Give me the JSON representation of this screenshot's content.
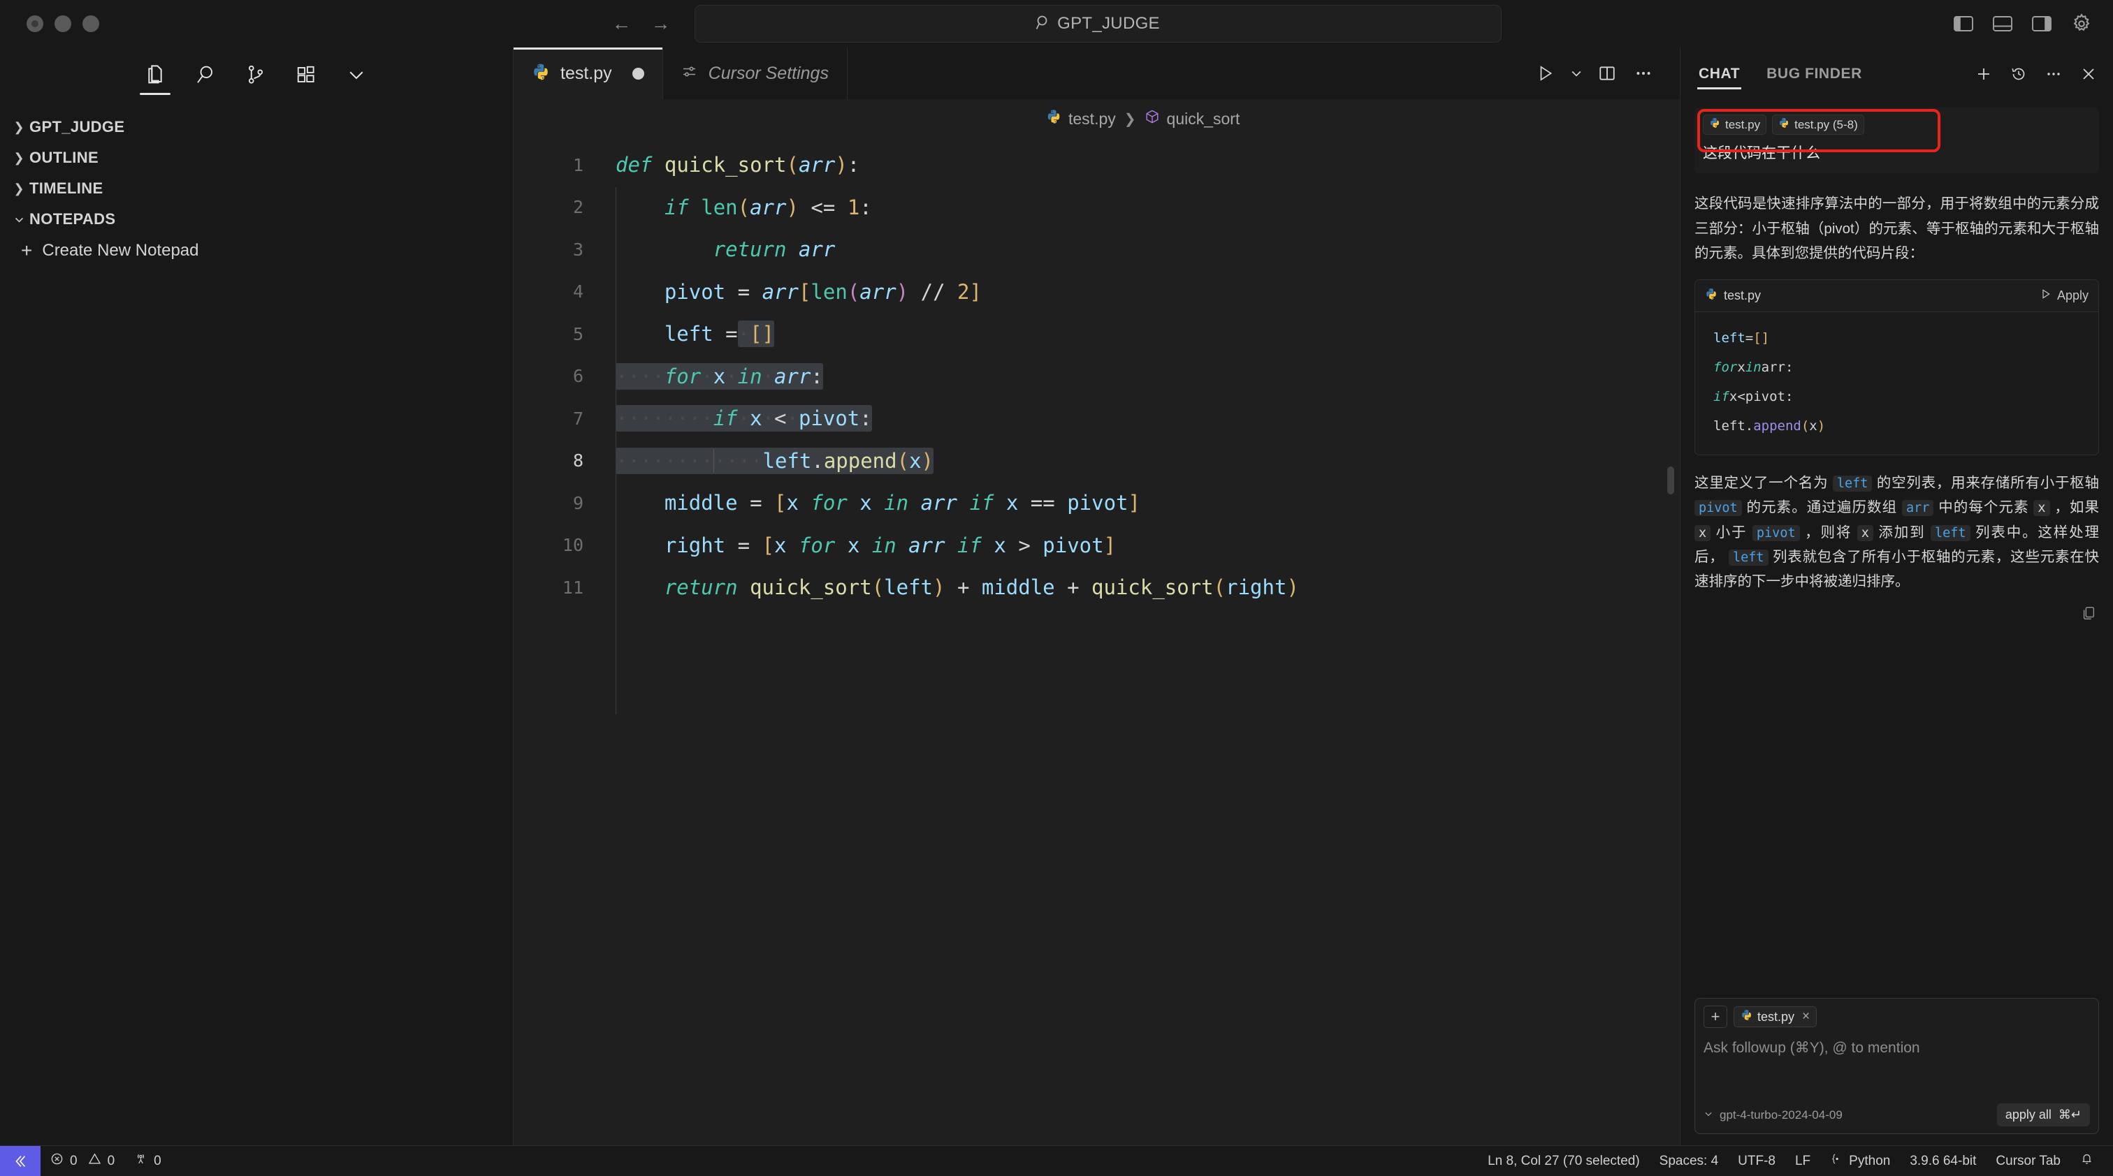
{
  "window": {
    "title": "GPT_JUDGE",
    "search_placeholder": "GPT_JUDGE",
    "traffic_lights": [
      "close",
      "minimize",
      "zoom"
    ]
  },
  "titlebar": {
    "back_icon": "←",
    "forward_icon": "→",
    "search_icon": "search-icon",
    "layout_buttons": [
      "toggle-primary-sidebar",
      "toggle-panel",
      "toggle-secondary-sidebar"
    ],
    "settings_icon": "gear-icon"
  },
  "sidebar": {
    "activity_icons": [
      "explorer-icon",
      "search-icon",
      "source-control-icon",
      "extensions-icon",
      "chevron-down-icon"
    ],
    "active_activity": "explorer-icon",
    "sections": [
      {
        "label": "GPT_JUDGE",
        "expanded": false
      },
      {
        "label": "OUTLINE",
        "expanded": false
      },
      {
        "label": "TIMELINE",
        "expanded": false
      },
      {
        "label": "NOTEPADS",
        "expanded": true
      }
    ],
    "notepad_action": "Create New Notepad"
  },
  "editor": {
    "tabs": [
      {
        "label": "test.py",
        "icon": "python-icon",
        "active": true,
        "dirty": true
      },
      {
        "label": "Cursor Settings",
        "icon": "settings-sliders-icon",
        "active": false,
        "dirty": false
      }
    ],
    "toolbar": [
      "run-icon",
      "chevron-down-icon",
      "split-editor-icon",
      "more-actions-icon"
    ],
    "breadcrumb": [
      {
        "label": "test.py",
        "icon": "python-icon"
      },
      {
        "label": "quick_sort",
        "icon": "symbol-method-icon"
      }
    ],
    "selection_lines": [
      6,
      7,
      8
    ],
    "lines": [
      {
        "n": 1,
        "text": "def quick_sort(arr):"
      },
      {
        "n": 2,
        "text": "    if len(arr) <= 1:"
      },
      {
        "n": 3,
        "text": "        return arr"
      },
      {
        "n": 4,
        "text": "    pivot = arr[len(arr) // 2]"
      },
      {
        "n": 5,
        "text": "    left = []"
      },
      {
        "n": 6,
        "text": "    for x in arr:"
      },
      {
        "n": 7,
        "text": "        if x < pivot:"
      },
      {
        "n": 8,
        "text": "            left.append(x)"
      },
      {
        "n": 9,
        "text": "    middle = [x for x in arr if x == pivot]"
      },
      {
        "n": 10,
        "text": "    right = [x for x in arr if x > pivot]"
      },
      {
        "n": 11,
        "text": "    return quick_sort(left) + middle + quick_sort(right)"
      }
    ]
  },
  "chat": {
    "tabs": [
      {
        "label": "CHAT",
        "active": true
      },
      {
        "label": "BUG FINDER",
        "active": false
      }
    ],
    "header_actions": [
      "new-chat-icon",
      "history-icon",
      "more-icon",
      "close-icon"
    ],
    "user_message": {
      "chips": [
        {
          "label": "test.py",
          "icon": "python-icon"
        },
        {
          "label": "test.py (5-8)",
          "icon": "python-icon"
        }
      ],
      "text": "这段代码在干什么",
      "highlight_color": "#e8241c"
    },
    "answer": {
      "paragraph1": "这段代码是快速排序算法中的一部分，用于将数组中的元素分成三部分：小于枢轴（pivot）的元素、等于枢轴的元素和大于枢轴的元素。具体到您提供的代码片段：",
      "code_card": {
        "filename": "test.py",
        "file_icon": "python-icon",
        "apply_label": "Apply",
        "apply_icon": "play-icon",
        "lines": [
          "    left = []",
          "    for x in arr:",
          "        if x < pivot:",
          "            left.append(x)"
        ]
      },
      "paragraph2_parts": [
        {
          "t": "这里定义了一个名为 ",
          "code": false
        },
        {
          "t": "left",
          "code": true
        },
        {
          "t": " 的空列表，用来存储所有小于枢轴 ",
          "code": false
        },
        {
          "t": "pivot",
          "code": true
        },
        {
          "t": " 的元素。通过遍历数组 ",
          "code": false
        },
        {
          "t": "arr",
          "code": true
        },
        {
          "t": " 中的每个元素 ",
          "code": false
        },
        {
          "t": "x",
          "code": true,
          "plain": true
        },
        {
          "t": " ，如果 ",
          "code": false
        },
        {
          "t": "x",
          "code": true,
          "plain": true
        },
        {
          "t": " 小于 ",
          "code": false
        },
        {
          "t": "pivot",
          "code": true
        },
        {
          "t": " ，则将 ",
          "code": false
        },
        {
          "t": "x",
          "code": true,
          "plain": true
        },
        {
          "t": " 添加到 ",
          "code": false
        },
        {
          "t": "left",
          "code": true
        },
        {
          "t": " 列表中。这样处理后， ",
          "code": false
        },
        {
          "t": "left",
          "code": true
        },
        {
          "t": " 列表就包含了所有小于枢轴的元素，这些元素在快速排序的下一步中将被递归排序。",
          "code": false
        }
      ],
      "copy_icon": "copy-icon"
    },
    "composer": {
      "add_icon": "plus-icon",
      "chips": [
        {
          "label": "test.py",
          "icon": "python-icon",
          "close_icon": "×"
        }
      ],
      "placeholder": "Ask followup (⌘Y), @ to mention",
      "model": "gpt-4-turbo-2024-04-09",
      "model_chevron": "chevron-down-icon",
      "apply_all_label": "apply all",
      "apply_all_shortcut": "⌘↵"
    }
  },
  "statusbar": {
    "remote_icon": "remote-indicator-icon",
    "remote_color": "#5e5ce6",
    "errors_icon": "error-icon",
    "errors": "0",
    "warnings_icon": "warning-icon",
    "warnings": "0",
    "ports_icon": "radio-tower-icon",
    "ports": "0",
    "cursor_position": "Ln 8, Col 27 (70 selected)",
    "indentation": "Spaces: 4",
    "encoding": "UTF-8",
    "eol": "LF",
    "language": "Python",
    "interpreter": "3.9.6 64-bit",
    "cursor_tab": "Cursor Tab",
    "bell_icon": "bell-icon"
  }
}
